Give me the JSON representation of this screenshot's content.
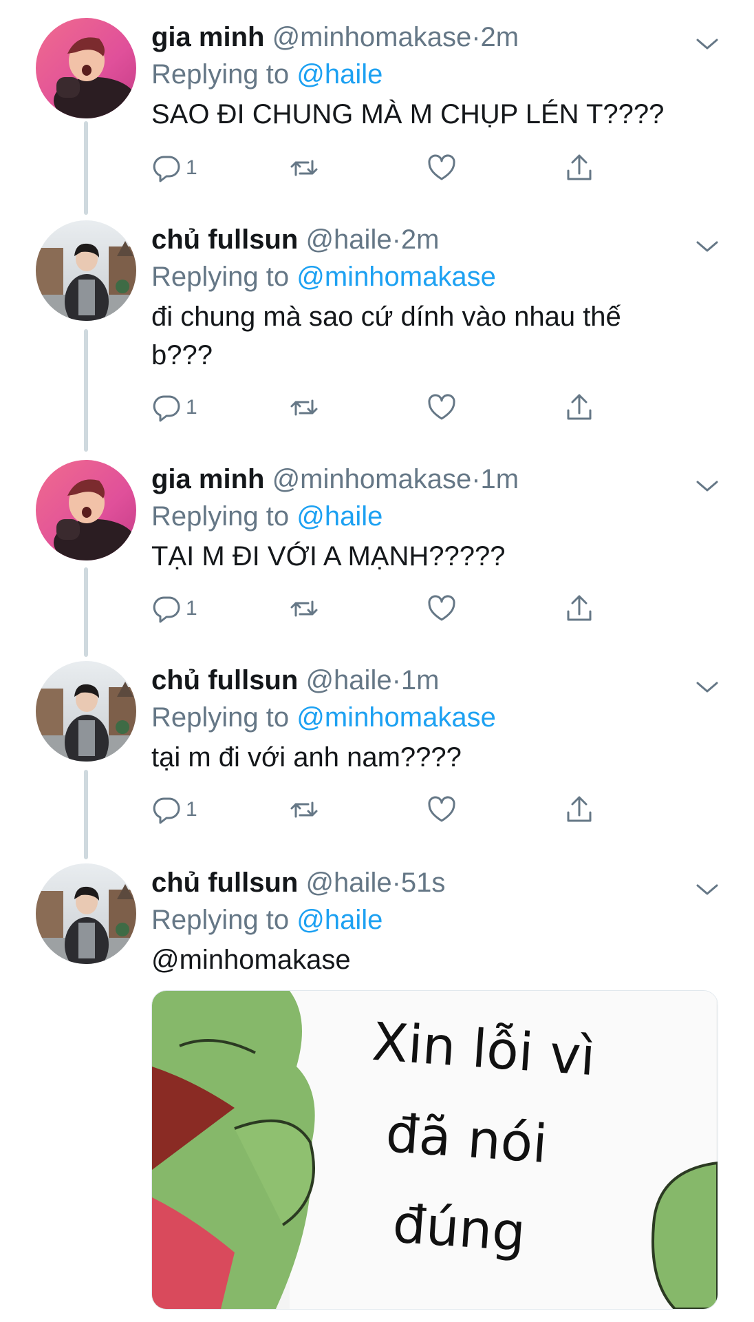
{
  "tweets": [
    {
      "name": "gia minh",
      "handle": "@minhomakase",
      "dot": "·",
      "time": "2m",
      "replying_prefix": "Replying to",
      "replying_to": "@haile",
      "text": "SAO ĐI CHUNG MÀ M CHỤP LÉN T????",
      "reply_count": "1",
      "avatar": "pink-avatar"
    },
    {
      "name": "chủ fullsun",
      "handle": "@haile",
      "dot": "·",
      "time": "2m",
      "replying_prefix": "Replying to",
      "replying_to": "@minhomakase",
      "text": "đi chung mà sao cứ dính vào nhau thế b???",
      "reply_count": "1",
      "avatar": "street-avatar"
    },
    {
      "name": "gia minh",
      "handle": "@minhomakase",
      "dot": "·",
      "time": "1m",
      "replying_prefix": "Replying to",
      "replying_to": "@haile",
      "text": "TẠI M ĐI VỚI A MẠNH?????",
      "reply_count": "1",
      "avatar": "pink-avatar"
    },
    {
      "name": "chủ fullsun",
      "handle": "@haile",
      "dot": "·",
      "time": "1m",
      "replying_prefix": "Replying to",
      "replying_to": "@minhomakase",
      "text": "tại m đi với anh nam????",
      "reply_count": "1",
      "avatar": "street-avatar"
    },
    {
      "name": "chủ fullsun",
      "handle": "@haile",
      "dot": "·",
      "time": "51s",
      "replying_prefix": "Replying to",
      "replying_to": "@haile",
      "text": "@minhomakase",
      "avatar": "street-avatar"
    }
  ],
  "meme": {
    "line1": "Xin lỗi vì",
    "line2": "đã nói",
    "line3": "đúng"
  },
  "colors": {
    "mention": "#1da1f2",
    "muted": "#657786",
    "thread_line": "#cfd9de"
  },
  "icons": [
    "reply-icon",
    "retweet-icon",
    "like-icon",
    "share-icon",
    "chevron-down-icon"
  ]
}
